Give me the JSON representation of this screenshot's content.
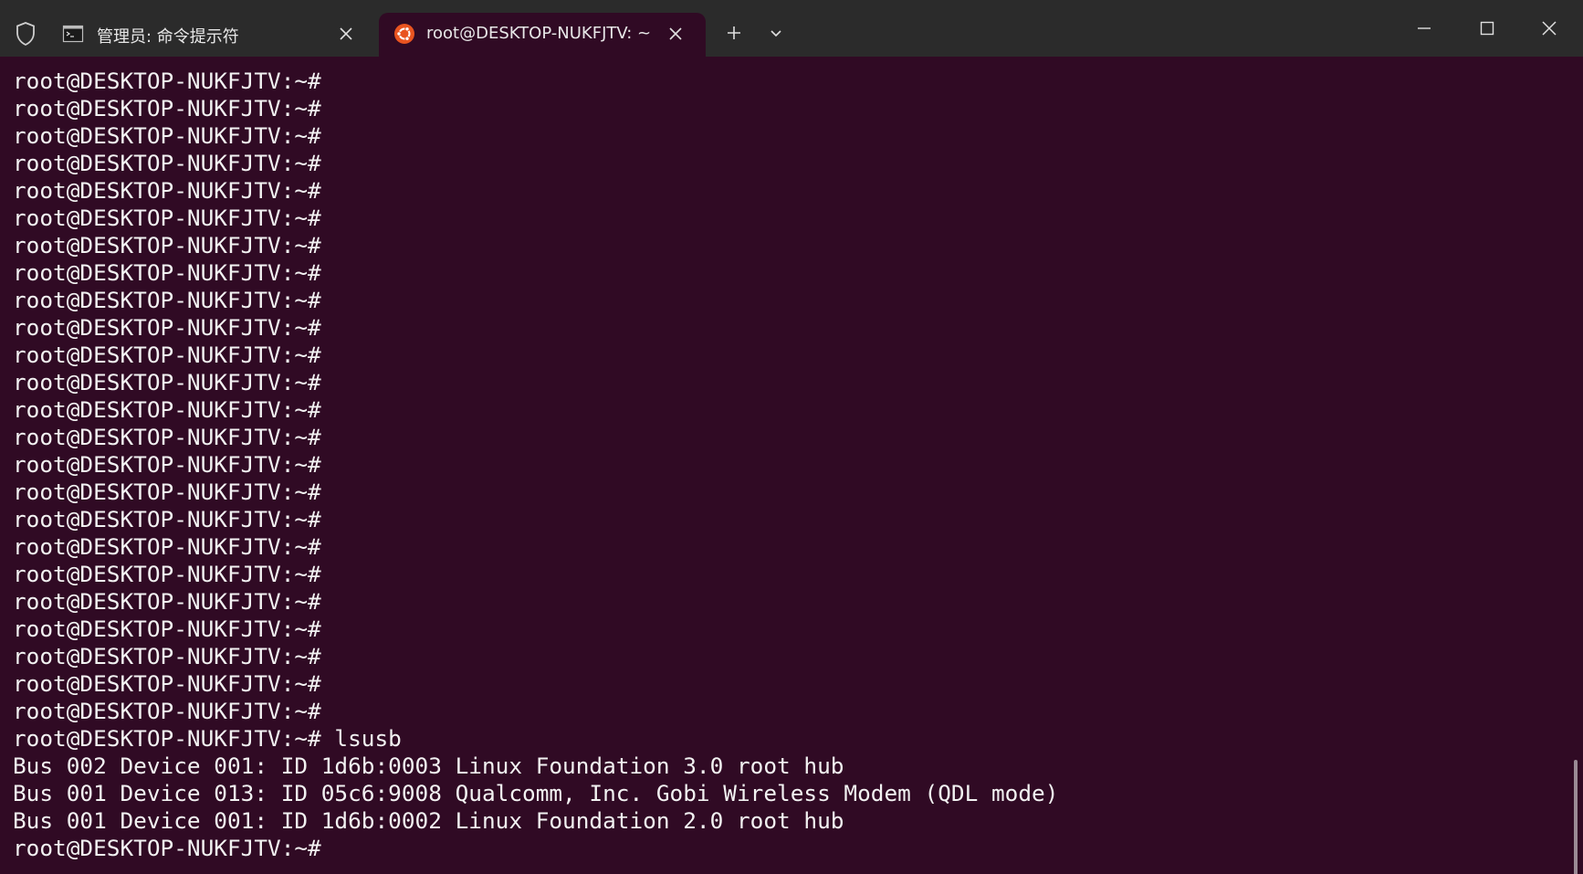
{
  "colors": {
    "titlebar": "#2b2b2b",
    "terminal_bg": "#300a24",
    "terminal_fg": "#f2f2f2",
    "ubuntu_orange": "#e95420"
  },
  "tabs": [
    {
      "label": "管理员: 命令提示符",
      "icon": "cmd-icon",
      "active": false
    },
    {
      "label": "root@DESKTOP-NUKFJTV: ~",
      "icon": "ubuntu-icon",
      "active": true
    }
  ],
  "terminal": {
    "lines": [
      "root@DESKTOP-NUKFJTV:~#",
      "root@DESKTOP-NUKFJTV:~#",
      "root@DESKTOP-NUKFJTV:~#",
      "root@DESKTOP-NUKFJTV:~#",
      "root@DESKTOP-NUKFJTV:~#",
      "root@DESKTOP-NUKFJTV:~#",
      "root@DESKTOP-NUKFJTV:~#",
      "root@DESKTOP-NUKFJTV:~#",
      "root@DESKTOP-NUKFJTV:~#",
      "root@DESKTOP-NUKFJTV:~#",
      "root@DESKTOP-NUKFJTV:~#",
      "root@DESKTOP-NUKFJTV:~#",
      "root@DESKTOP-NUKFJTV:~#",
      "root@DESKTOP-NUKFJTV:~#",
      "root@DESKTOP-NUKFJTV:~#",
      "root@DESKTOP-NUKFJTV:~#",
      "root@DESKTOP-NUKFJTV:~#",
      "root@DESKTOP-NUKFJTV:~#",
      "root@DESKTOP-NUKFJTV:~#",
      "root@DESKTOP-NUKFJTV:~#",
      "root@DESKTOP-NUKFJTV:~#",
      "root@DESKTOP-NUKFJTV:~#",
      "root@DESKTOP-NUKFJTV:~#",
      "root@DESKTOP-NUKFJTV:~#",
      "root@DESKTOP-NUKFJTV:~# lsusb",
      "Bus 002 Device 001: ID 1d6b:0003 Linux Foundation 3.0 root hub",
      "Bus 001 Device 013: ID 05c6:9008 Qualcomm, Inc. Gobi Wireless Modem (QDL mode)",
      "Bus 001 Device 001: ID 1d6b:0002 Linux Foundation 2.0 root hub",
      "root@DESKTOP-NUKFJTV:~#"
    ]
  }
}
